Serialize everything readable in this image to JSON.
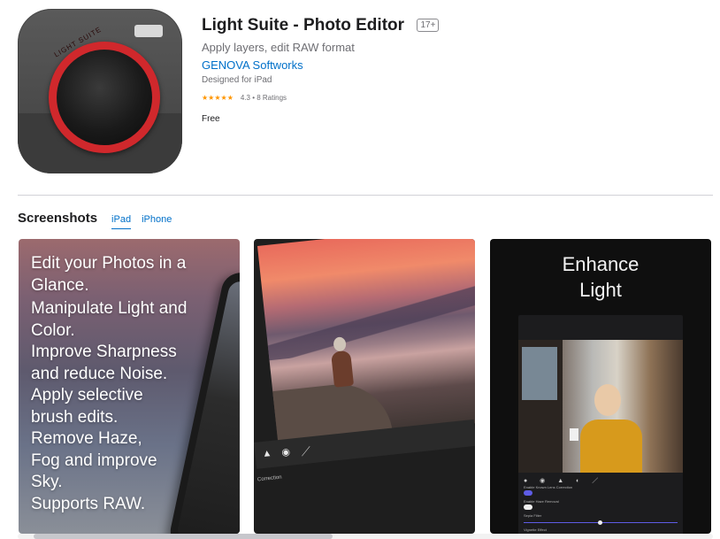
{
  "app": {
    "title": "Light Suite - Photo Editor",
    "age_rating": "17+",
    "subtitle": "Apply layers, edit RAW format",
    "developer": "GENOVA Softworks",
    "designed_for": "Designed for iPad",
    "stars": "★★★★★",
    "rating_text": "4.3 • 8 Ratings",
    "rating_value": 4.3,
    "price": "Free",
    "icon_text": "LIGHT SUITE"
  },
  "screenshots": {
    "title": "Screenshots",
    "tabs": [
      {
        "label": "iPad",
        "active": true
      },
      {
        "label": "iPhone",
        "active": false
      }
    ],
    "items": [
      {
        "lines": [
          "Edit your Photos in a",
          "Glance.",
          "Manipulate Light and",
          "Color.",
          "Improve Sharpness",
          "and reduce Noise.",
          "Apply selective",
          "brush edits.",
          "Remove Haze,",
          "Fog and improve",
          "Sky.",
          "Supports RAW."
        ]
      },
      {
        "tool_label": "Correction"
      },
      {
        "heading_lines": [
          "Enhance",
          "Light"
        ],
        "control_labels": [
          "Enable Known Lens Correction",
          "Enable Haze Removal",
          "Sepia Filter",
          "Vignette Effect"
        ]
      }
    ]
  },
  "colors": {
    "link": "#0070c9",
    "text": "#1d1d1f",
    "secondary": "#6e6e73",
    "star": "#ff9500",
    "icon_ring": "#d0282c"
  },
  "icons": {
    "app_icon": "camera-lens-icon"
  }
}
